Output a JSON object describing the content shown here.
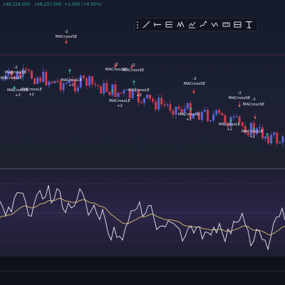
{
  "header": {
    "price_a": "148,228.000",
    "price_b": "148,237.000",
    "change": "+1,000 (+0.05%)"
  },
  "toolbar": {
    "tools": [
      {
        "name": "trendline-tool-icon"
      },
      {
        "name": "horizontal-ray-tool-icon"
      },
      {
        "name": "fib-levels-tool-icon"
      },
      {
        "name": "pattern-tool-icon"
      },
      {
        "name": "projection-tool-icon"
      },
      {
        "name": "brush-tool-icon"
      },
      {
        "name": "text-tool-icon"
      },
      {
        "name": "measure-tool-icon"
      },
      {
        "name": "long-position-tool-icon"
      },
      {
        "name": "short-position-tool-icon"
      }
    ]
  },
  "annotations": [
    {
      "id": "a1",
      "lines": [
        "-2",
        "MACrossSE"
      ]
    },
    {
      "id": "a2",
      "lines": [
        "-2",
        "MACrossSE"
      ]
    },
    {
      "id": "a3",
      "lines": [
        "-2",
        "MACrossSE"
      ]
    },
    {
      "id": "a4",
      "lines": [
        "-2",
        "MACrossSE"
      ]
    },
    {
      "id": "a5",
      "lines": [
        "-2",
        "MACrossSE"
      ]
    },
    {
      "id": "a6",
      "lines": [
        "-2",
        "MACrossSE"
      ]
    },
    {
      "id": "a7",
      "lines": [
        "-2",
        "MACrossSE"
      ]
    },
    {
      "id": "a8",
      "lines": [
        "-2",
        "MACrossSE"
      ]
    },
    {
      "id": "a9",
      "lines": [
        "MACrossLE",
        "+2"
      ]
    },
    {
      "id": "a10",
      "lines": [
        "MACrossLE",
        "+2"
      ]
    },
    {
      "id": "a11",
      "lines": [
        "MACrossLE",
        "+2"
      ]
    },
    {
      "id": "a12",
      "lines": [
        "MACrossLE",
        "+2"
      ]
    },
    {
      "id": "a13",
      "lines": [
        "MACrossLE",
        "+2"
      ]
    },
    {
      "id": "a14",
      "lines": [
        "MACrossLE",
        "+2"
      ]
    },
    {
      "id": "a15",
      "lines": [
        "MACrossLE",
        "+2"
      ]
    },
    {
      "id": "a16",
      "lines": [
        "MACrossLE",
        "+2"
      ]
    }
  ],
  "colors": {
    "up_candle": "#5b63d6",
    "down_candle": "#cc3b4f",
    "long_arrow": "#2ea987",
    "short_arrow": "#e04a5a",
    "oscillator_line": "#e6e8ef",
    "signal_line": "#c9b36a",
    "price_level_line": "#b83a4a"
  }
}
